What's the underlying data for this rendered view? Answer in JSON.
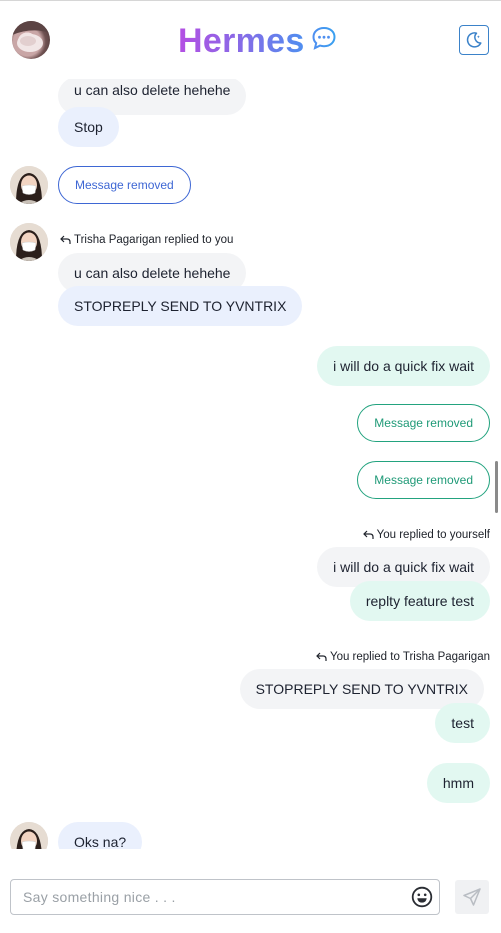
{
  "header": {
    "title": "Hermes",
    "brand_icon": "chat-bubble-icon",
    "theme_icon": "moon-icon",
    "accent": "#8b68e6"
  },
  "messages": {
    "m1_partial": "u can also delete hehehe",
    "m2": "Stop",
    "m3_removed": "Message removed",
    "m4_reply_note": "Trisha Pagarigan replied to you",
    "m4_quoted": "u can also delete hehehe",
    "m4_text": "STOPREPLY SEND TO YVNTRIX",
    "m5": "i will do a quick fix wait",
    "m6_removed": "Message removed",
    "m7_removed": "Message removed",
    "m8_reply_note": "You replied to yourself",
    "m8_quoted": "i will do a quick fix wait",
    "m8_text": "replty feature test",
    "m9_reply_note": "You replied to Trisha Pagarigan",
    "m9_quoted": "STOPREPLY SEND TO YVNTRIX",
    "m9_text": "test",
    "m10": "hmm",
    "m11": "Oks na?"
  },
  "composer": {
    "placeholder": "Say something nice . . .",
    "emoji_icon": "smiley-icon",
    "send_icon": "send-icon"
  },
  "colors": {
    "incoming_bubble": "#eaf0fd",
    "outgoing_bubble": "#e2f8f1",
    "removed_in": "#3e67d4",
    "removed_out": "#23a37f"
  }
}
